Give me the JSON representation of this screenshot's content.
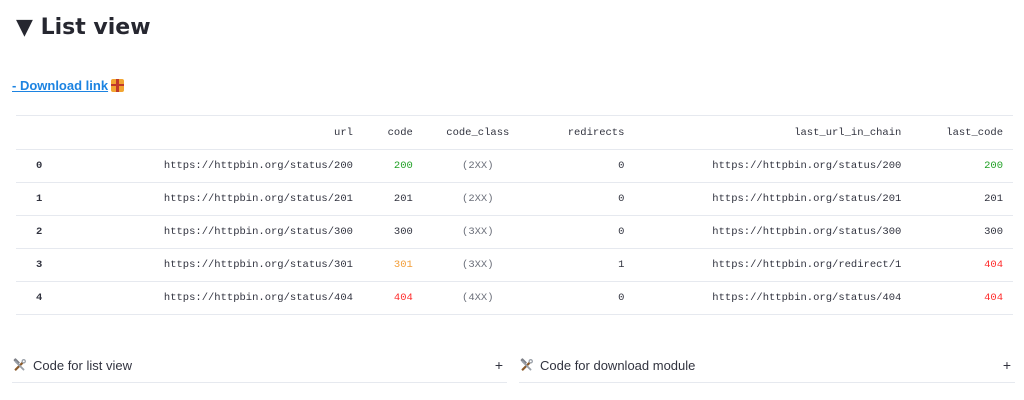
{
  "section": {
    "title": "▼ List view"
  },
  "download": {
    "label": "- Download link"
  },
  "table": {
    "columns": [
      "",
      "url",
      "code",
      "code_class",
      "redirects",
      "last_url_in_chain",
      "last_code"
    ],
    "rows": [
      {
        "index": "0",
        "url": "https://httpbin.org/status/200",
        "code": "200",
        "code_class": "(2XX)",
        "redirects": "0",
        "last_url_in_chain": "https://httpbin.org/status/200",
        "last_code": "200"
      },
      {
        "index": "1",
        "url": "https://httpbin.org/status/201",
        "code": "201",
        "code_class": "(2XX)",
        "redirects": "0",
        "last_url_in_chain": "https://httpbin.org/status/201",
        "last_code": "201"
      },
      {
        "index": "2",
        "url": "https://httpbin.org/status/300",
        "code": "300",
        "code_class": "(3XX)",
        "redirects": "0",
        "last_url_in_chain": "https://httpbin.org/status/300",
        "last_code": "300"
      },
      {
        "index": "3",
        "url": "https://httpbin.org/status/301",
        "code": "301",
        "code_class": "(3XX)",
        "redirects": "1",
        "last_url_in_chain": "https://httpbin.org/redirect/1",
        "last_code": "404"
      },
      {
        "index": "4",
        "url": "https://httpbin.org/status/404",
        "code": "404",
        "code_class": "(4XX)",
        "redirects": "0",
        "last_url_in_chain": "https://httpbin.org/status/404",
        "last_code": "404"
      }
    ]
  },
  "code_colors": {
    "200": "#21a126",
    "301": "#f29d38",
    "404": "#ff2b2b"
  },
  "expanders": [
    {
      "label": "Code for list view",
      "icon": "hammer-wrench-icon",
      "toggle": "+"
    },
    {
      "label": "Code for download module",
      "icon": "hammer-wrench-icon",
      "toggle": "+"
    }
  ]
}
